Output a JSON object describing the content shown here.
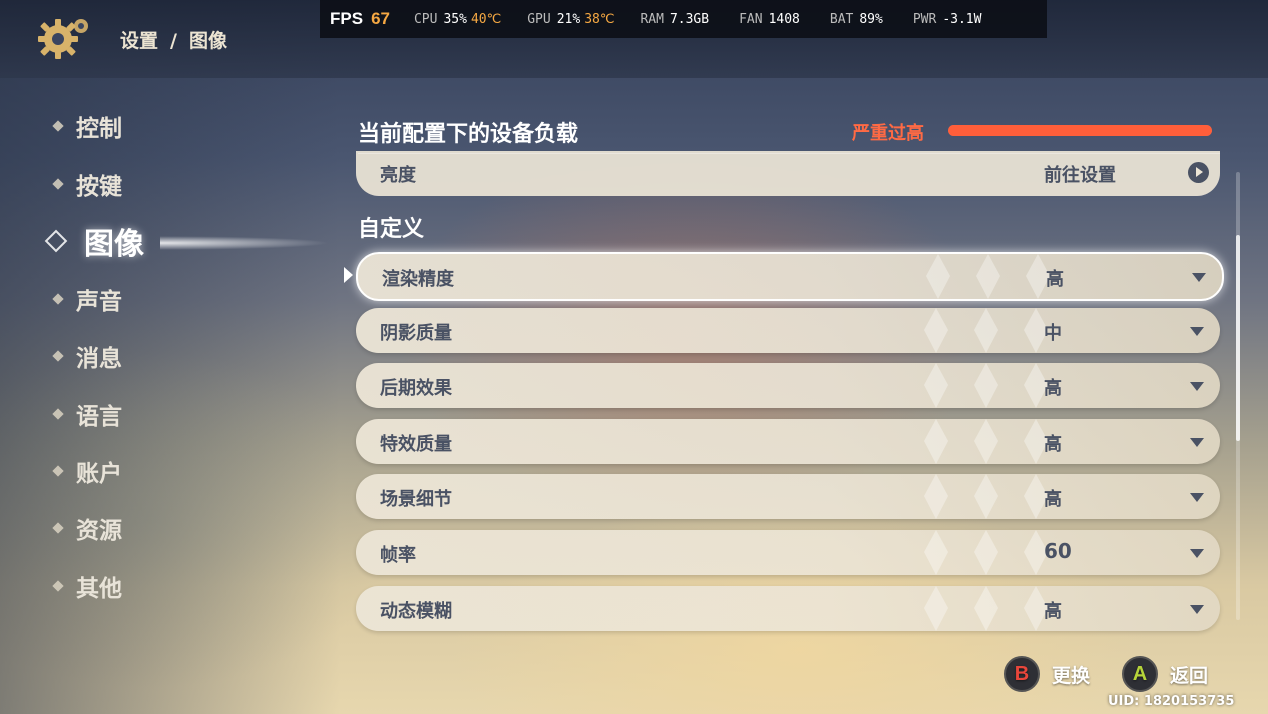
{
  "header": {
    "breadcrumb_parent": "设置",
    "breadcrumb_sep": "/",
    "breadcrumb_current": "图像"
  },
  "hud": {
    "fps_label": "FPS",
    "fps_value": "67",
    "cpu_label": "CPU",
    "cpu_value": "35%",
    "cpu_temp": "40℃",
    "gpu_label": "GPU",
    "gpu_value": "21%",
    "gpu_temp": "38℃",
    "ram_label": "RAM",
    "ram_value": "7.3GB",
    "fan_label": "FAN",
    "fan_value": "1408",
    "bat_label": "BAT",
    "bat_value": "89%",
    "pwr_label": "PWR",
    "pwr_value": "-3.1W"
  },
  "sidebar": {
    "items": [
      {
        "label": "控制",
        "active": false
      },
      {
        "label": "按键",
        "active": false
      },
      {
        "label": "图像",
        "active": true
      },
      {
        "label": "声音",
        "active": false
      },
      {
        "label": "消息",
        "active": false
      },
      {
        "label": "语言",
        "active": false
      },
      {
        "label": "账户",
        "active": false
      },
      {
        "label": "资源",
        "active": false
      },
      {
        "label": "其他",
        "active": false
      }
    ]
  },
  "load": {
    "title": "当前配置下的设备负载",
    "status": "严重过高",
    "level": 1.0,
    "color": "#ff5e3a"
  },
  "brightness": {
    "label": "亮度",
    "action": "前往设置"
  },
  "section_title": "自定义",
  "settings": [
    {
      "label": "渲染精度",
      "value": "高",
      "selected": true
    },
    {
      "label": "阴影质量",
      "value": "中"
    },
    {
      "label": "后期效果",
      "value": "高"
    },
    {
      "label": "特效质量",
      "value": "高"
    },
    {
      "label": "场景细节",
      "value": "高"
    },
    {
      "label": "帧率",
      "value": "60"
    },
    {
      "label": "动态模糊",
      "value": "高"
    }
  ],
  "scroll": {
    "position": 0.14,
    "visible_fraction": 0.46
  },
  "footer": {
    "b_key": "B",
    "b_label": "更换",
    "a_key": "A",
    "a_label": "返回",
    "uid": "UID: 1820153735"
  },
  "colors": {
    "b_button": "#e8463b",
    "a_button": "#b6d43a",
    "accent_orange": "#f5a843"
  }
}
